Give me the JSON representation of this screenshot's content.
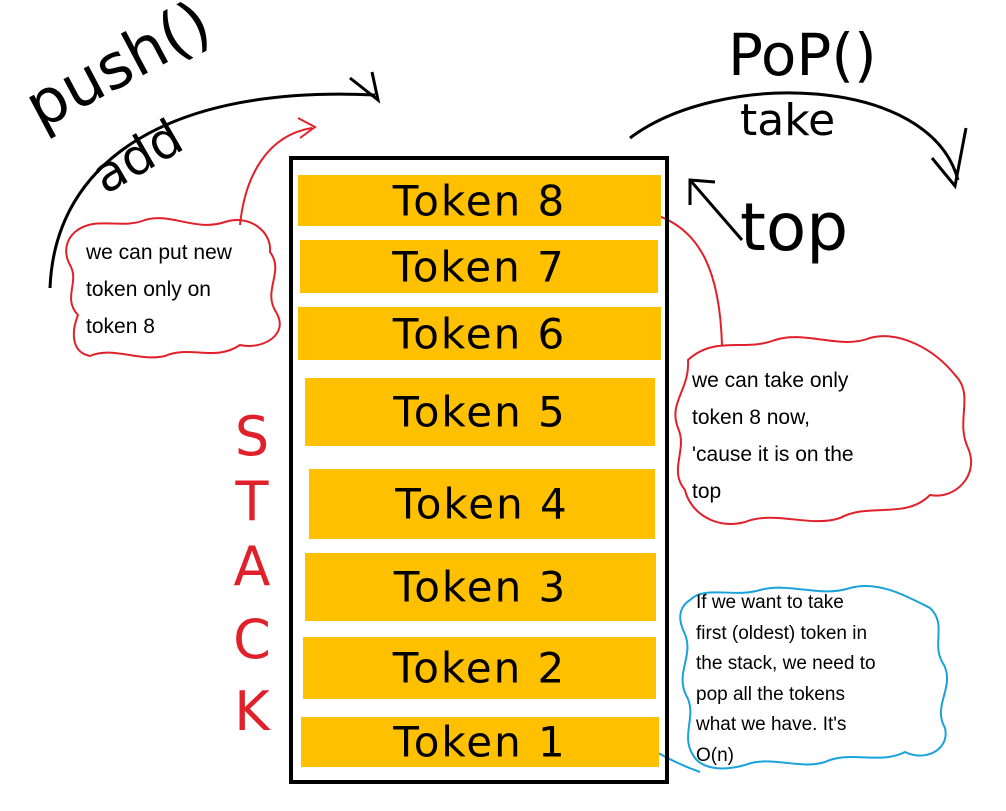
{
  "labels": {
    "push": "push()",
    "add": "add",
    "pop": "PoP()",
    "take": "take",
    "top": "top"
  },
  "stack_letters": [
    "S",
    "T",
    "A",
    "C",
    "K"
  ],
  "tokens": [
    "Token 8",
    "Token 7",
    "Token 6",
    "Token 5",
    "Token 4",
    "Token 3",
    "Token 2",
    "Token 1"
  ],
  "notes": {
    "push_note": [
      "we can put new",
      "token only on",
      "token 8"
    ],
    "top_note": [
      "we can take only",
      "token 8 now,",
      "'cause it is on the",
      "top"
    ],
    "pop_all_note": [
      "If we want to take",
      "first (oldest) token in",
      "the stack, we need to",
      "pop all the tokens",
      "what we have. It's",
      "O(n)"
    ]
  },
  "colors": {
    "bar": "#ffc000",
    "red_annotation": "#e0212b",
    "blue_annotation": "#1aa2dc",
    "ink": "#000000"
  }
}
